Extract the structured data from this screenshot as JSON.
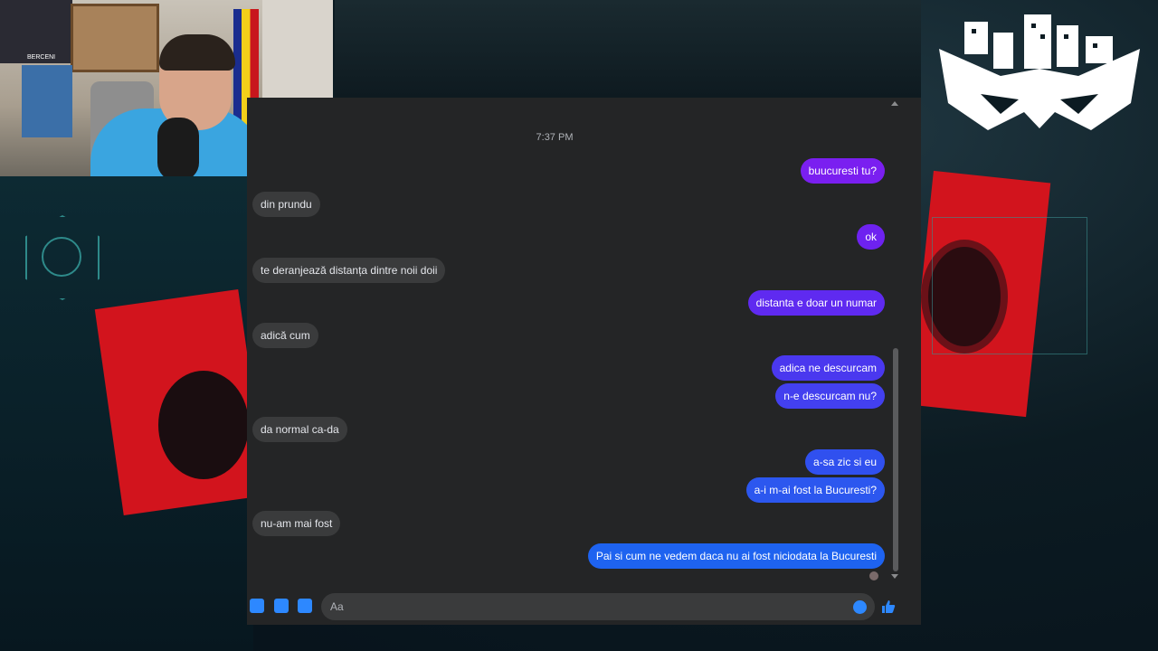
{
  "chat": {
    "timestamp": "7:37 PM",
    "messages": [
      {
        "side": "out",
        "text": "buucuresti tu?"
      },
      {
        "side": "in",
        "text": "din prundu"
      },
      {
        "side": "out",
        "text": "ok"
      },
      {
        "side": "in",
        "text": "te deranjează distanța  dintre noii doii"
      },
      {
        "side": "out",
        "text": "distanta e doar un numar"
      },
      {
        "side": "in",
        "text": "adică cum"
      },
      {
        "side": "out",
        "text": "adica ne descurcam"
      },
      {
        "side": "out",
        "text": "n-e descurcam nu?"
      },
      {
        "side": "in",
        "text": "da normal ca-da"
      },
      {
        "side": "out",
        "text": "a-sa zic si eu"
      },
      {
        "side": "out",
        "text": "a-i m-ai fost la Bucuresti?"
      },
      {
        "side": "in",
        "text": "nu-am mai fost"
      },
      {
        "side": "out",
        "text": "Pai si cum ne vedem daca nu ai fost niciodata la Bucuresti"
      }
    ]
  },
  "composer": {
    "placeholder": "Aa",
    "icons": [
      "more-actions-icon",
      "sticker-icon",
      "gif-icon"
    ],
    "emoji_icon": "smiley-icon",
    "like_icon": "thumbs-up-icon"
  },
  "colors": {
    "chat_bg": "#242526",
    "incoming_bubble": "#3a3b3c",
    "outgoing_top": "#7b1ff2",
    "outgoing_bottom": "#1e63f0"
  },
  "overlay": {
    "webcam_caption": "BERCENI"
  }
}
